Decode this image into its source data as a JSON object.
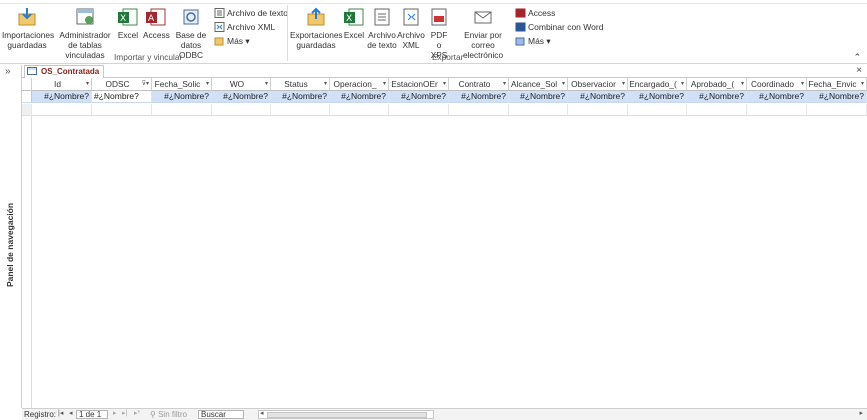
{
  "ribbon": {
    "import_group": {
      "label": "Importar y vincular",
      "saved_imports": "Importaciones guardadas",
      "linked_table_manager": "Administrador de tablas vinculadas",
      "excel": "Excel",
      "access": "Access",
      "odbc": "Base de datos ODBC",
      "text_file": "Archivo de texto",
      "xml_file": "Archivo XML",
      "more": "Más"
    },
    "export_group": {
      "label": "Exportar",
      "saved_exports": "Exportaciones guardadas",
      "excel": "Excel",
      "text_file": "Archivo de texto",
      "xml_file": "Archivo XML",
      "pdf_xps": "PDF o XPS",
      "email": "Enviar por correo electrónico",
      "access": "Access",
      "word_merge": "Combinar con Word",
      "more": "Más"
    }
  },
  "nav_pane": {
    "label": "Panel de navegación",
    "toggle": "»"
  },
  "document": {
    "tab_title": "OS_Contratada",
    "close": "×"
  },
  "datasheet": {
    "columns": [
      "Id",
      "ODSC",
      "Fecha_Solic",
      "WO",
      "Status",
      "Operacion_",
      "EstacionOEr",
      "Contrato",
      "Alcance_Sol",
      "Observacior",
      "Encargado_(",
      "Aprobado_(",
      "Coordinado",
      "Fecha_Envic"
    ],
    "cells": [
      "#¿Nombre?",
      "#¿Nombre?",
      "#¿Nombre?",
      "#¿Nombre?",
      "#¿Nombre?",
      "#¿Nombre?",
      "#¿Nombre?",
      "#¿Nombre?",
      "#¿Nombre?",
      "#¿Nombre?",
      "#¿Nombre?",
      "#¿Nombre?",
      "#¿Nombre?",
      "#¿Nombre?"
    ]
  },
  "statusbar": {
    "records_label": "Registro:",
    "record_position": "1 de 1",
    "filter": "Sin filtro",
    "search": "Buscar"
  },
  "colors": {
    "selected_row": "#cfe0f7",
    "tab_text": "#8b2020"
  }
}
